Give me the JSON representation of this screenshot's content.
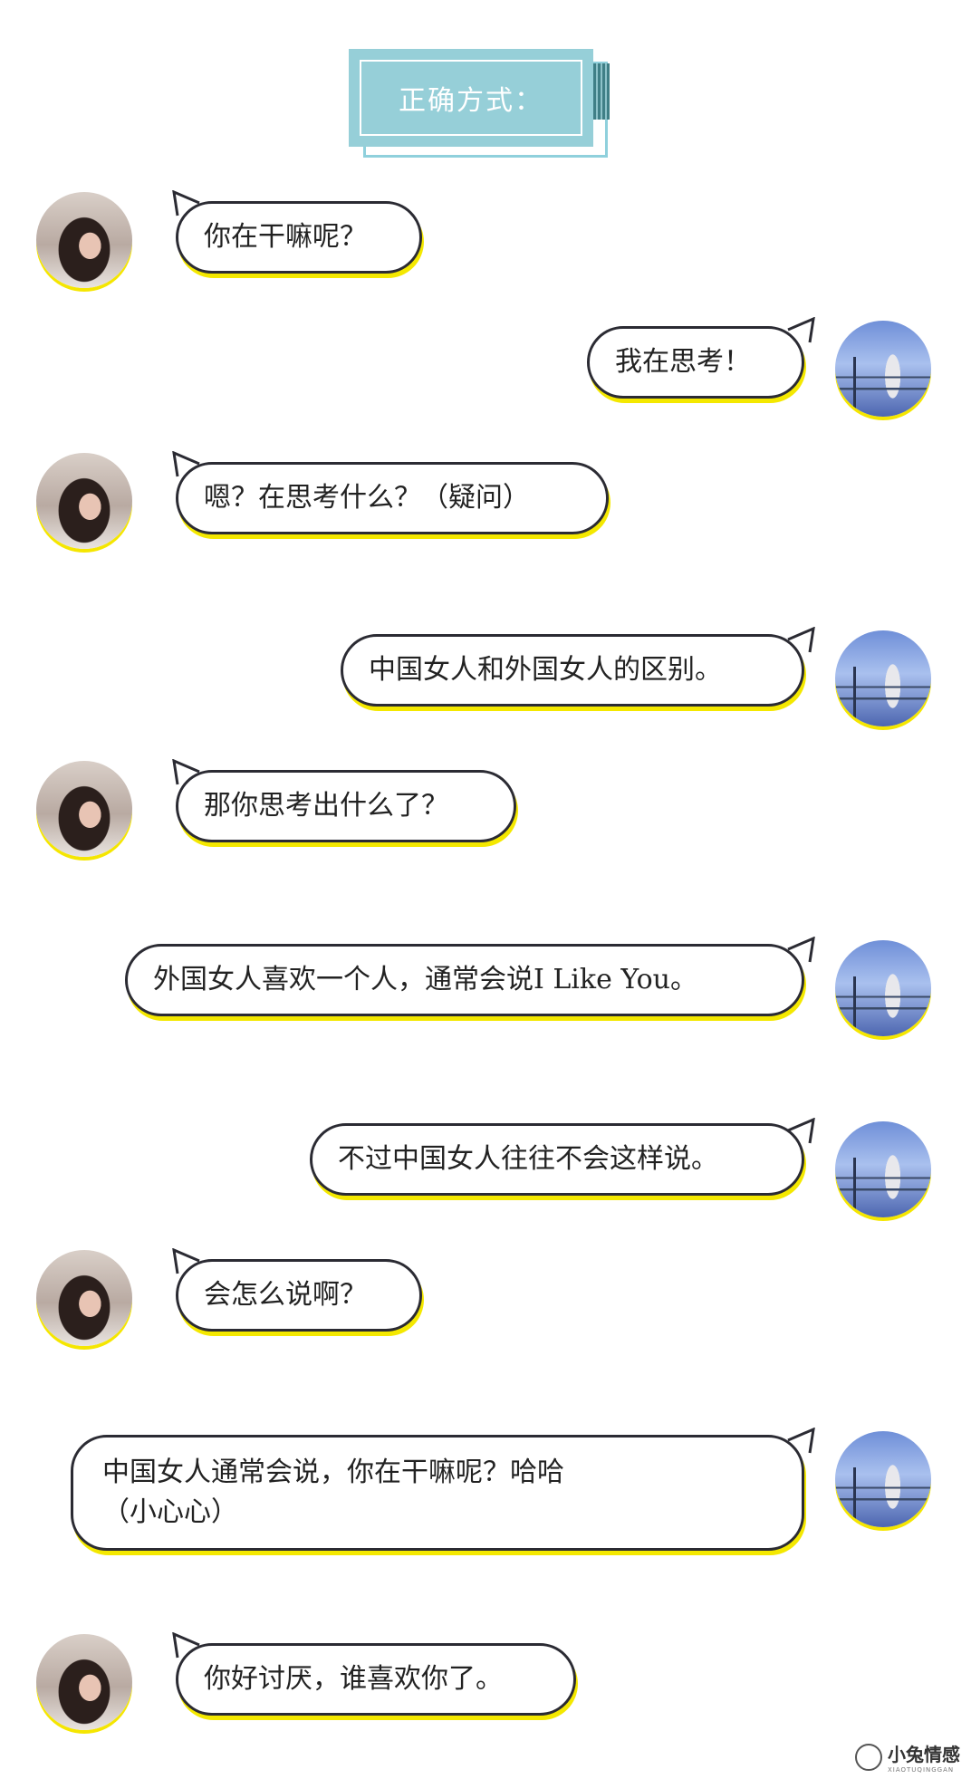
{
  "header": {
    "title": "正确方式："
  },
  "messages": [
    {
      "side": "left",
      "text": "你在干嘛呢？"
    },
    {
      "side": "right",
      "text": "我在思考！"
    },
    {
      "side": "left",
      "text": "嗯？在思考什么？（疑问）"
    },
    {
      "side": "right",
      "text": "中国女人和外国女人的区别。"
    },
    {
      "side": "left",
      "text": "那你思考出什么了？"
    },
    {
      "side": "right",
      "text": "外国女人喜欢一个人，通常会说I Like You。"
    },
    {
      "side": "right",
      "text": "不过中国女人往往不会这样说。"
    },
    {
      "side": "left",
      "text": "会怎么说啊？"
    },
    {
      "side": "right",
      "text": "中国女人通常会说，你在干嘛呢？哈哈（小心心）"
    },
    {
      "side": "left",
      "text": "你好讨厌，谁喜欢你了。"
    }
  ],
  "watermark": {
    "name": "小兔情感",
    "sub": "XIAOTUQINGGAN"
  },
  "colors": {
    "title_bg": "#96cfd8",
    "bubble_shadow": "#f4e800",
    "bubble_border": "#2b2b33"
  }
}
